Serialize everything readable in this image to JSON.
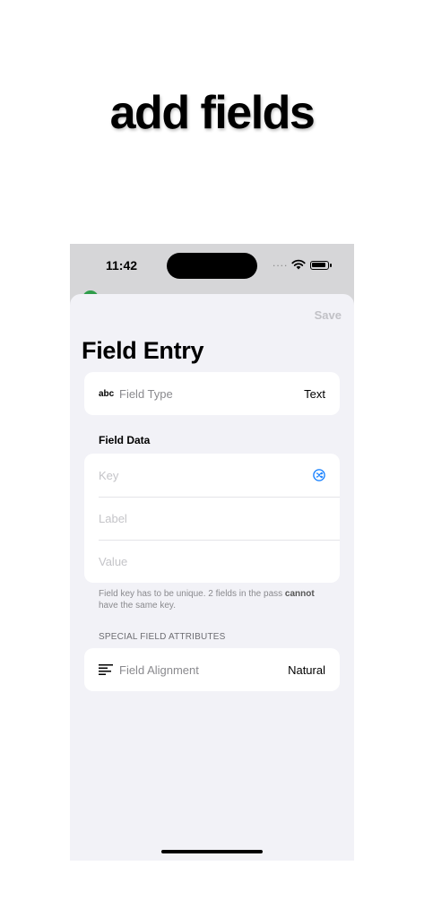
{
  "headline": "add fields",
  "status_bar": {
    "time": "11:42",
    "dots": "...."
  },
  "toolbar": {
    "save_label": "Save"
  },
  "page_title": "Field Entry",
  "field_type": {
    "icon_text": "abc",
    "label": "Field Type",
    "value": "Text"
  },
  "field_data": {
    "section_title": "Field Data",
    "key_placeholder": "Key",
    "label_placeholder": "Label",
    "value_placeholder": "Value",
    "footnote_prefix": "Field key has to be unique. 2 fields in the pass ",
    "footnote_bold": "cannot",
    "footnote_suffix": " have the same key."
  },
  "special": {
    "section_title": "SPECIAL FIELD ATTRIBUTES",
    "alignment_label": "Field Alignment",
    "alignment_value": "Natural"
  },
  "icons": [
    "wifi-icon",
    "battery-icon",
    "shuffle-icon",
    "text-align-icon"
  ],
  "colors": {
    "accent": "#0a7aff",
    "sheet_background": "#f2f2f7",
    "disabled": "#c1c1c6"
  }
}
